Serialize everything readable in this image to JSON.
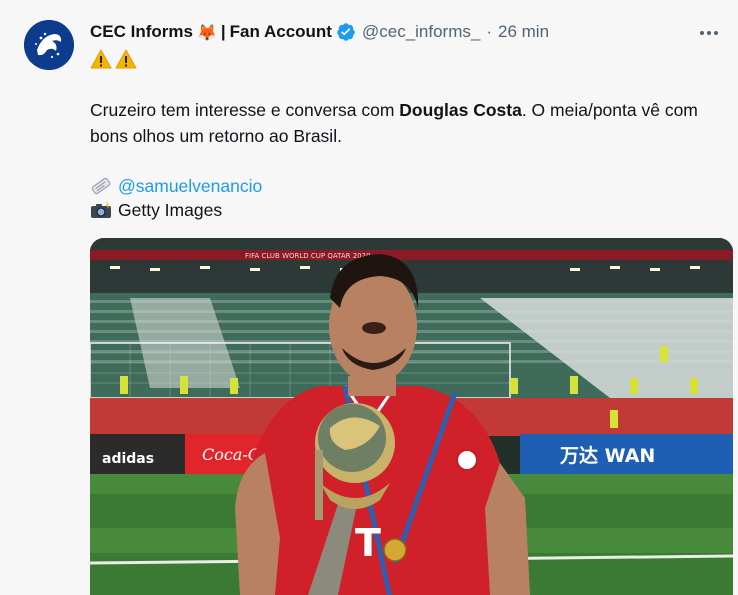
{
  "account": {
    "display_name": "CEC Informs",
    "name_emoji": "🦊",
    "separator": "|",
    "subtitle": "Fan Account",
    "handle": "@cec_informs_",
    "dot": "·",
    "time": "26 min"
  },
  "tweet": {
    "warning_emoji": "⚠️",
    "text_part1": "Cruzeiro tem interesse e conversa com ",
    "text_bold": "Douglas Costa",
    "text_part2": ". O meia/ponta vê com bons olhos um retorno ao Brasil.",
    "credit_icon": "🗞️",
    "mention": "@samuelvenancio",
    "photo_icon": "📸",
    "photo_credit": "Getty Images"
  },
  "photo": {
    "stadium_banner": "FIFA CLUB WORLD CUP QATAR 2020",
    "board_adidas": "adidas",
    "board_cocacola": "Coca-Cola",
    "board_wanda": "万达 WAN",
    "shirt_text": "T"
  },
  "colors": {
    "avatar_bg": "#0d3b8e",
    "verified": "#1d9bf0",
    "mention": "#1d9bf0",
    "jersey_red": "#d0202a",
    "pitch_green": "#3b7a33"
  },
  "icons": {
    "more": "more-horizontal-icon",
    "verified": "verified-badge-icon"
  }
}
